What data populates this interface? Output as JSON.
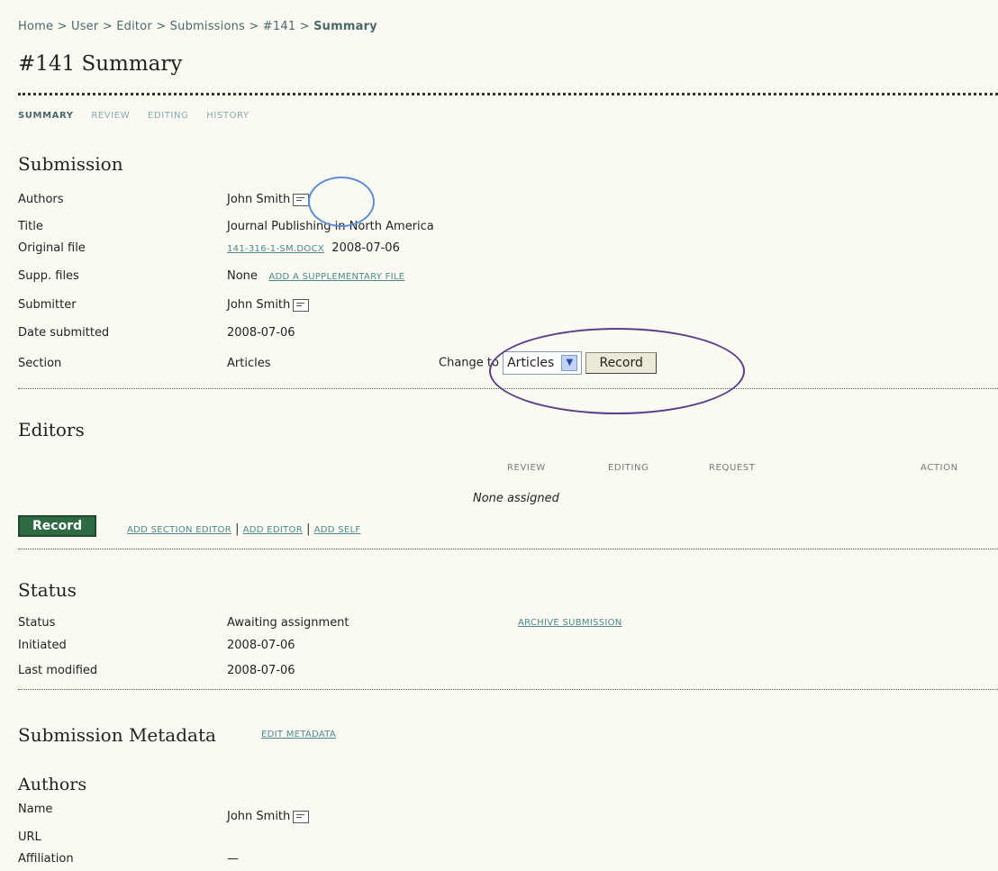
{
  "breadcrumb": {
    "items": [
      "Home",
      "User",
      "Editor",
      "Submissions",
      "#141"
    ],
    "current": "Summary",
    "separator": ">"
  },
  "page": {
    "title": "#141 Summary"
  },
  "tabs": [
    "SUMMARY",
    "REVIEW",
    "EDITING",
    "HISTORY"
  ],
  "submission": {
    "heading": "Submission",
    "authors_label": "Authors",
    "authors_value": "John Smith",
    "title_label": "Title",
    "title_value": "Journal Publishing in North America",
    "original_file_label": "Original file",
    "original_file_link": "141-316-1-SM.DOCX",
    "original_file_date": "2008-07-06",
    "supp_files_label": "Supp. files",
    "supp_files_value": "None",
    "supp_files_link": "ADD A SUPPLEMENTARY FILE",
    "submitter_label": "Submitter",
    "submitter_value": "John Smith",
    "date_submitted_label": "Date submitted",
    "date_submitted_value": "2008-07-06",
    "section_label": "Section",
    "section_value": "Articles",
    "change_to_label": "Change to",
    "section_select": "Articles",
    "record_button": "Record"
  },
  "editors": {
    "heading": "Editors",
    "columns": [
      "REVIEW",
      "EDITING",
      "REQUEST",
      "ACTION"
    ],
    "empty_text": "None assigned",
    "record_button": "Record",
    "links": [
      "ADD SECTION EDITOR",
      "ADD EDITOR",
      "ADD SELF"
    ],
    "link_sep": "|"
  },
  "status": {
    "heading": "Status",
    "status_label": "Status",
    "status_value": "Awaiting assignment",
    "archive_link": "ARCHIVE SUBMISSION",
    "initiated_label": "Initiated",
    "initiated_value": "2008-07-06",
    "modified_label": "Last modified",
    "modified_value": "2008-07-06"
  },
  "metadata": {
    "heading": "Submission Metadata",
    "edit_link": "EDIT METADATA",
    "authors_heading": "Authors",
    "name_label": "Name",
    "name_value": "John Smith",
    "url_label": "URL",
    "affiliation_label": "Affiliation",
    "affiliation_value": "—"
  },
  "icons": {
    "email": "email-icon",
    "dropdown": "chevron-down-icon"
  },
  "colors": {
    "background": "#fafaf3",
    "link": "#4a8a8a",
    "record_green": "#2e6b45",
    "annotation_blue": "#5b8fd6",
    "annotation_purple": "#5b3d8a"
  }
}
